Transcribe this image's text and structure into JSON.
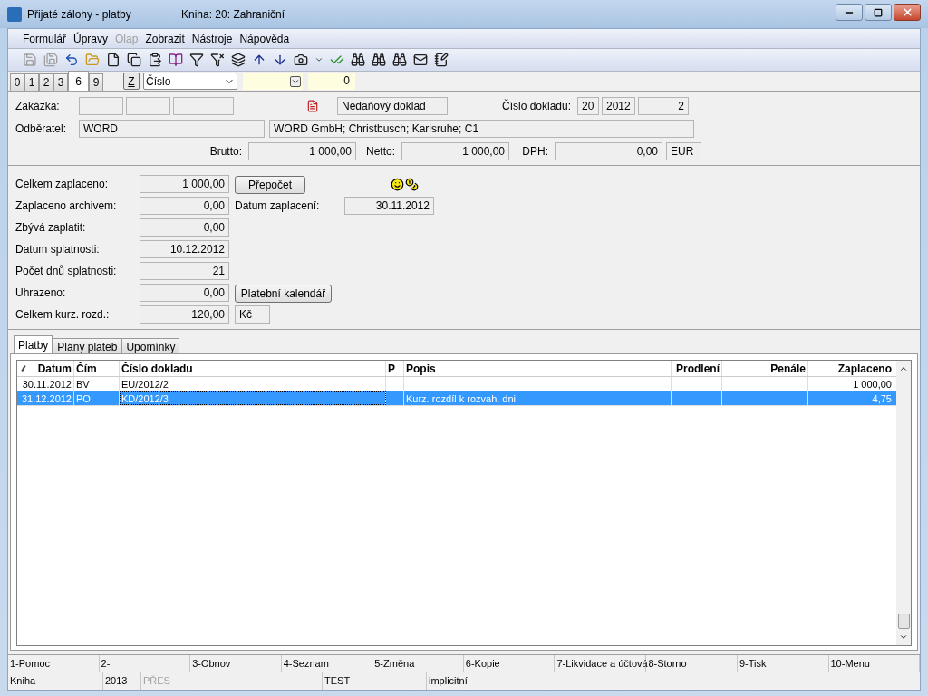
{
  "window": {
    "title": "Přijaté zálohy - platby",
    "book": "Kniha: 20: Zahraniční"
  },
  "menu": [
    {
      "label": "Formulář",
      "disabled": false
    },
    {
      "label": "Úpravy",
      "disabled": false
    },
    {
      "label": "Olap",
      "disabled": true
    },
    {
      "label": "Zobrazit",
      "disabled": false
    },
    {
      "label": "Nástroje",
      "disabled": false
    },
    {
      "label": "Nápověda",
      "disabled": false
    }
  ],
  "toolbar": [
    {
      "kind": "save",
      "disabled": true
    },
    {
      "kind": "save-out",
      "disabled": true
    },
    {
      "kind": "undo",
      "disabled": false
    },
    {
      "kind": "folder",
      "disabled": false
    },
    {
      "kind": "file",
      "disabled": false
    },
    {
      "kind": "copy",
      "disabled": false
    },
    {
      "kind": "paste",
      "disabled": false
    },
    {
      "kind": "book",
      "disabled": false
    },
    {
      "kind": "filter",
      "disabled": false
    },
    {
      "kind": "filter-doc",
      "disabled": false
    },
    {
      "kind": "stack",
      "disabled": false
    },
    {
      "kind": "up",
      "disabled": false
    },
    {
      "kind": "down",
      "disabled": false
    },
    {
      "kind": "camera",
      "disabled": false
    },
    {
      "kind": "caret",
      "disabled": false
    },
    {
      "kind": "check",
      "disabled": false
    },
    {
      "kind": "binoculars",
      "disabled": false
    },
    {
      "kind": "binoculars",
      "disabled": false
    },
    {
      "kind": "binoculars",
      "disabled": false
    },
    {
      "kind": "mail",
      "disabled": false
    },
    {
      "kind": "notepad",
      "disabled": false
    }
  ],
  "view_tabs": [
    {
      "label": "0",
      "selected": false
    },
    {
      "label": "1",
      "selected": false
    },
    {
      "label": "2",
      "selected": false
    },
    {
      "label": "3",
      "selected": false
    },
    {
      "label": "6",
      "selected": true
    },
    {
      "label": "9",
      "selected": false
    }
  ],
  "sort_button": "Z",
  "sort_field": "Číslo",
  "filter_value": "0",
  "header": {
    "order_label": "Zakázka:",
    "doc_type": "Nedaňový doklad",
    "doc_number_label": "Číslo dokladu:",
    "doc_number": [
      "20",
      "2012",
      "2"
    ],
    "customer_label": "Odběratel:",
    "customer_code": "WORD",
    "customer_address": "WORD GmbH; Christbusch; Karlsruhe; C1",
    "amounts": [
      {
        "label": "Brutto:",
        "value": "1 000,00"
      },
      {
        "label": "Netto:",
        "value": "1 000,00"
      },
      {
        "label": "DPH:",
        "value": "0,00"
      }
    ],
    "currency": "EUR"
  },
  "payment": [
    {
      "kind": "button",
      "label": "Celkem zaplaceno:",
      "value": "1 000,00",
      "button": "Přepočet"
    },
    {
      "kind": "date",
      "label": "Zaplaceno archivem:",
      "value": "0,00",
      "extra_label": "Datum zaplacení:",
      "extra_value": "30.11.2012"
    },
    {
      "kind": "plain",
      "label": "Zbývá zaplatit:",
      "value": "0,00"
    },
    {
      "kind": "plain",
      "label": "Datum splatnosti:",
      "value": "10.12.2012"
    },
    {
      "kind": "plain",
      "label": "Počet dnů splatnosti:",
      "value": "21"
    },
    {
      "kind": "button",
      "label": "Uhrazeno:",
      "value": "0,00",
      "button": "Platební kalendář"
    },
    {
      "kind": "unit",
      "label": "Celkem kurz. rozd.:",
      "value": "120,00",
      "unit": "Kč"
    }
  ],
  "detail_tabs": [
    {
      "label": "Platby",
      "selected": true
    },
    {
      "label": "Plány plateb",
      "selected": false
    },
    {
      "label": "Upomínky",
      "selected": false
    }
  ],
  "table": {
    "columns": [
      {
        "label": "Datum",
        "kind": "number"
      },
      {
        "label": "Čím",
        "kind": "text"
      },
      {
        "label": "Číslo dokladu",
        "kind": "text"
      },
      {
        "label": "P",
        "kind": "text"
      },
      {
        "label": "Popis",
        "kind": "text"
      },
      {
        "label": "Prodlení",
        "kind": "number"
      },
      {
        "label": "Penále",
        "kind": "number"
      },
      {
        "label": "Zaplaceno",
        "kind": "number"
      }
    ],
    "rows": [
      {
        "selected": false,
        "cells": [
          "30.11.2012",
          "BV",
          "EU/2012/2",
          "",
          "",
          "",
          "",
          "1 000,00"
        ]
      },
      {
        "selected": true,
        "cells": [
          "31.12.2012",
          "PO",
          "KD/2012/3",
          "",
          "Kurz. rozdíl k rozvah. dni",
          "",
          "",
          "4,75"
        ]
      }
    ]
  },
  "function_keys": [
    "1-Pomoc",
    "2-",
    "3-Obnov",
    "4-Seznam",
    "5-Změna",
    "6-Kopie",
    "7-Likvidace a účtová",
    "8-Storno",
    "9-Tisk",
    "10-Menu"
  ],
  "status_bar": [
    {
      "text": "Kniha",
      "disabled": false
    },
    {
      "text": "2013",
      "disabled": false
    },
    {
      "text": "PŘES",
      "disabled": true
    },
    {
      "text": "TEST",
      "disabled": false
    },
    {
      "text": "implicitní",
      "disabled": false
    }
  ]
}
